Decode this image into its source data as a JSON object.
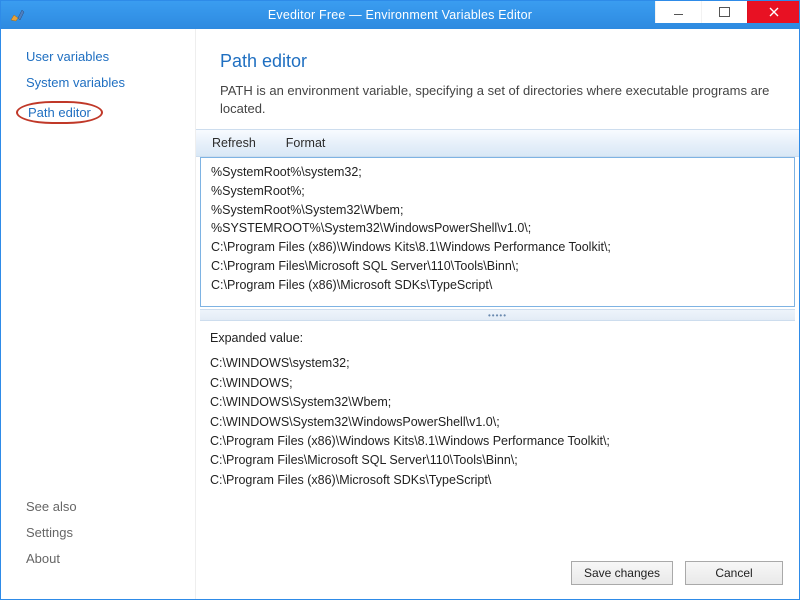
{
  "window": {
    "title": "Eveditor Free — Environment Variables Editor"
  },
  "sidebar": {
    "items": [
      {
        "label": "User variables",
        "selected": false
      },
      {
        "label": "System variables",
        "selected": false
      },
      {
        "label": "Path editor",
        "selected": true
      }
    ],
    "seeAlsoHeading": "See also",
    "bottomItems": [
      {
        "label": "Settings"
      },
      {
        "label": "About"
      }
    ]
  },
  "page": {
    "title": "Path editor",
    "description": "PATH is an environment variable, specifying a set of directories where executable programs are located."
  },
  "toolbar": {
    "refresh": "Refresh",
    "format": "Format"
  },
  "pathEditor": {
    "raw": "%SystemRoot%\\system32;\n%SystemRoot%;\n%SystemRoot%\\System32\\Wbem;\n%SYSTEMROOT%\\System32\\WindowsPowerShell\\v1.0\\;\nC:\\Program Files (x86)\\Windows Kits\\8.1\\Windows Performance Toolkit\\;\nC:\\Program Files\\Microsoft SQL Server\\110\\Tools\\Binn\\;\nC:\\Program Files (x86)\\Microsoft SDKs\\TypeScript\\"
  },
  "expanded": {
    "label": "Expanded value:",
    "value": "C:\\WINDOWS\\system32;\nC:\\WINDOWS;\nC:\\WINDOWS\\System32\\Wbem;\nC:\\WINDOWS\\System32\\WindowsPowerShell\\v1.0\\;\nC:\\Program Files (x86)\\Windows Kits\\8.1\\Windows Performance Toolkit\\;\nC:\\Program Files\\Microsoft SQL Server\\110\\Tools\\Binn\\;\nC:\\Program Files (x86)\\Microsoft SDKs\\TypeScript\\"
  },
  "footer": {
    "save": "Save changes",
    "cancel": "Cancel"
  },
  "splitter": {
    "dots": "•••••"
  }
}
